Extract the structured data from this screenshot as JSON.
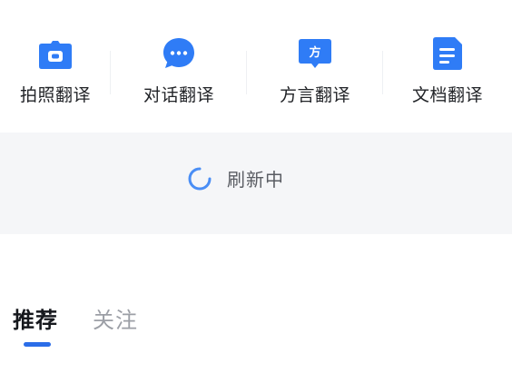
{
  "tools": [
    {
      "label": "拍照翻译",
      "icon": "camera-icon"
    },
    {
      "label": "对话翻译",
      "icon": "chat-bubble-icon"
    },
    {
      "label": "方言翻译",
      "icon": "dialect-icon",
      "icon_text": "方"
    },
    {
      "label": "文档翻译",
      "icon": "document-icon"
    }
  ],
  "refresh": {
    "text": "刷新中",
    "icon": "loading-spinner-icon"
  },
  "tabs": [
    {
      "label": "推荐",
      "active": true
    },
    {
      "label": "关注",
      "active": false
    }
  ],
  "colors": {
    "accent": "#2b6de8",
    "icon_blue": "#2f7cf6",
    "band_bg": "#f5f6f8",
    "text_primary": "#222428",
    "text_muted": "#9c9fa6"
  }
}
